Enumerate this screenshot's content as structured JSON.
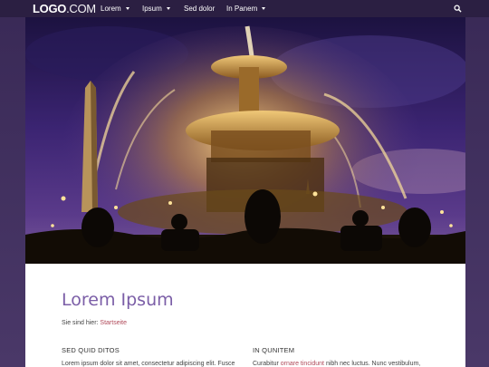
{
  "nav": {
    "logo_bold": "LOGO",
    "logo_thin": ".COM",
    "items": [
      {
        "label": "Lorem",
        "has_dropdown": true
      },
      {
        "label": "Ipsum",
        "has_dropdown": true
      },
      {
        "label": "Sed dolor",
        "has_dropdown": false
      },
      {
        "label": "In Panem",
        "has_dropdown": true
      }
    ],
    "search_icon": "search-icon"
  },
  "hero": {
    "image_icon": "photo"
  },
  "main": {
    "title": "Lorem Ipsum",
    "breadcrumb_prefix": "Sie sind hier:",
    "breadcrumb_link": "Startseite",
    "columns": [
      {
        "heading": "SED QUID DITOS",
        "text_before": "Lorem ipsum dolor sit amet, consectetur adipiscing elit. Fusce",
        "link": "",
        "text_after": ""
      },
      {
        "heading": "IN QUNITEM",
        "text_before": "Curabitur",
        "link": "ornare tincidunt",
        "text_after": "nibh nec luctus. Nunc vestibulum,"
      }
    ]
  },
  "colors": {
    "accent": "#7b5ea7",
    "link": "#b04a5a",
    "nav_bg": "#2b1f42",
    "page_bg": "#3e2c5c"
  }
}
